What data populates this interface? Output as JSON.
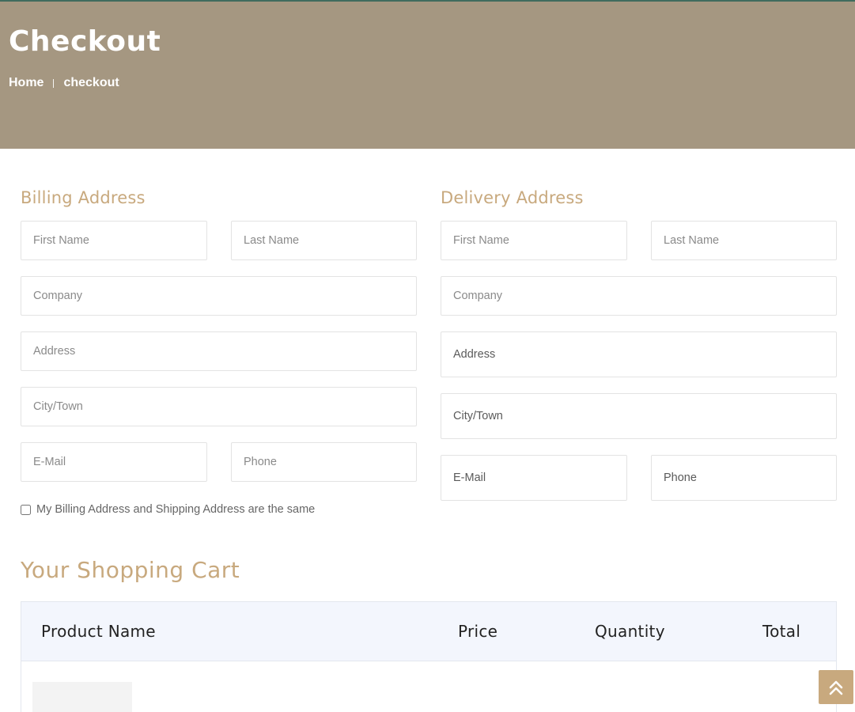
{
  "hero": {
    "title": "Checkout",
    "breadcrumb": {
      "home": "Home",
      "current": "checkout"
    }
  },
  "billing": {
    "title": "Billing Address",
    "first_name": "First Name",
    "last_name": "Last Name",
    "company": "Company",
    "address": "Address",
    "city": "City/Town",
    "email": "E-Mail",
    "phone": "Phone",
    "same_label": "My Billing Address and Shipping Address are the same",
    "same_checked": false
  },
  "delivery": {
    "title": "Delivery Address",
    "first_name": "First Name",
    "last_name": "Last Name",
    "company": "Company",
    "address": "Address",
    "city": "City/Town",
    "email": "E-Mail",
    "phone": "Phone"
  },
  "cart": {
    "title": "Your Shopping Cart",
    "columns": [
      "Product Name",
      "Price",
      "Quantity",
      "Total"
    ]
  },
  "icons": {
    "scroll_top": "double-chevron-up-icon"
  },
  "colors": {
    "hero_bg": "#a59781",
    "accent": "#c8a97e",
    "table_head_bg": "#f3f6fd"
  }
}
